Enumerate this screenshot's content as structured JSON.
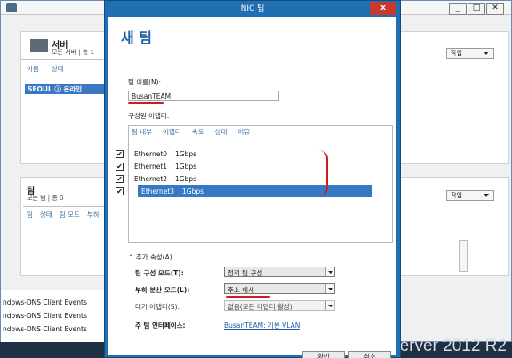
{
  "background_window": {
    "servers_title": "서버",
    "servers_sub": "모든 서버 | 총 1",
    "servers_cols": [
      "이름",
      "상태"
    ],
    "selected_server": "SEOUL ⓘ 온라인",
    "work_button": "작업",
    "teams_title": "팀",
    "teams_sub": "모든 팀 | 총 0",
    "teams_cols": [
      "팀",
      "상태",
      "팀 모드",
      "부하"
    ],
    "events": [
      "ndows-DNS Client Events",
      "ndows-DNS Client Events",
      "ndows-DNS Client Events"
    ],
    "os_logo": "erver 2012 R2"
  },
  "dialog": {
    "title": "NIC 팀",
    "close": "x",
    "heading": "새 팀",
    "team_name_label": "팀 이름(N):",
    "team_name_value": "BusanTEAM",
    "member_label": "구성원 어댑터:",
    "columns": [
      "팀 내부",
      "어댑터",
      "속도",
      "상태",
      "이유"
    ],
    "adapters": [
      {
        "name": "Ethernet0",
        "speed": "1Gbps",
        "checked": true
      },
      {
        "name": "Ethernet1",
        "speed": "1Gbps",
        "checked": true
      },
      {
        "name": "Ethernet2",
        "speed": "1Gbps",
        "checked": true
      },
      {
        "name": "Ethernet3",
        "speed": "1Gbps",
        "checked": true
      }
    ],
    "additional_props": "추가 속성(A)",
    "team_mode_label": "팀 구성 모드(T):",
    "team_mode_value": "정적 팀 구성",
    "lb_label": "부하 분산 모드(L):",
    "lb_value": "주소 해시",
    "standby_label": "대기 어댑터(S):",
    "standby_value": "없음(모든 어댑터 활성)",
    "primary_label": "주 팀 인터페이스:",
    "primary_link": "BusanTEAM: 기본 VLAN",
    "ok": "확인",
    "cancel": "취소"
  },
  "colors": {
    "accent": "#1f6fb2",
    "selection": "#3579c4",
    "annotation": "#cc1e1e"
  }
}
